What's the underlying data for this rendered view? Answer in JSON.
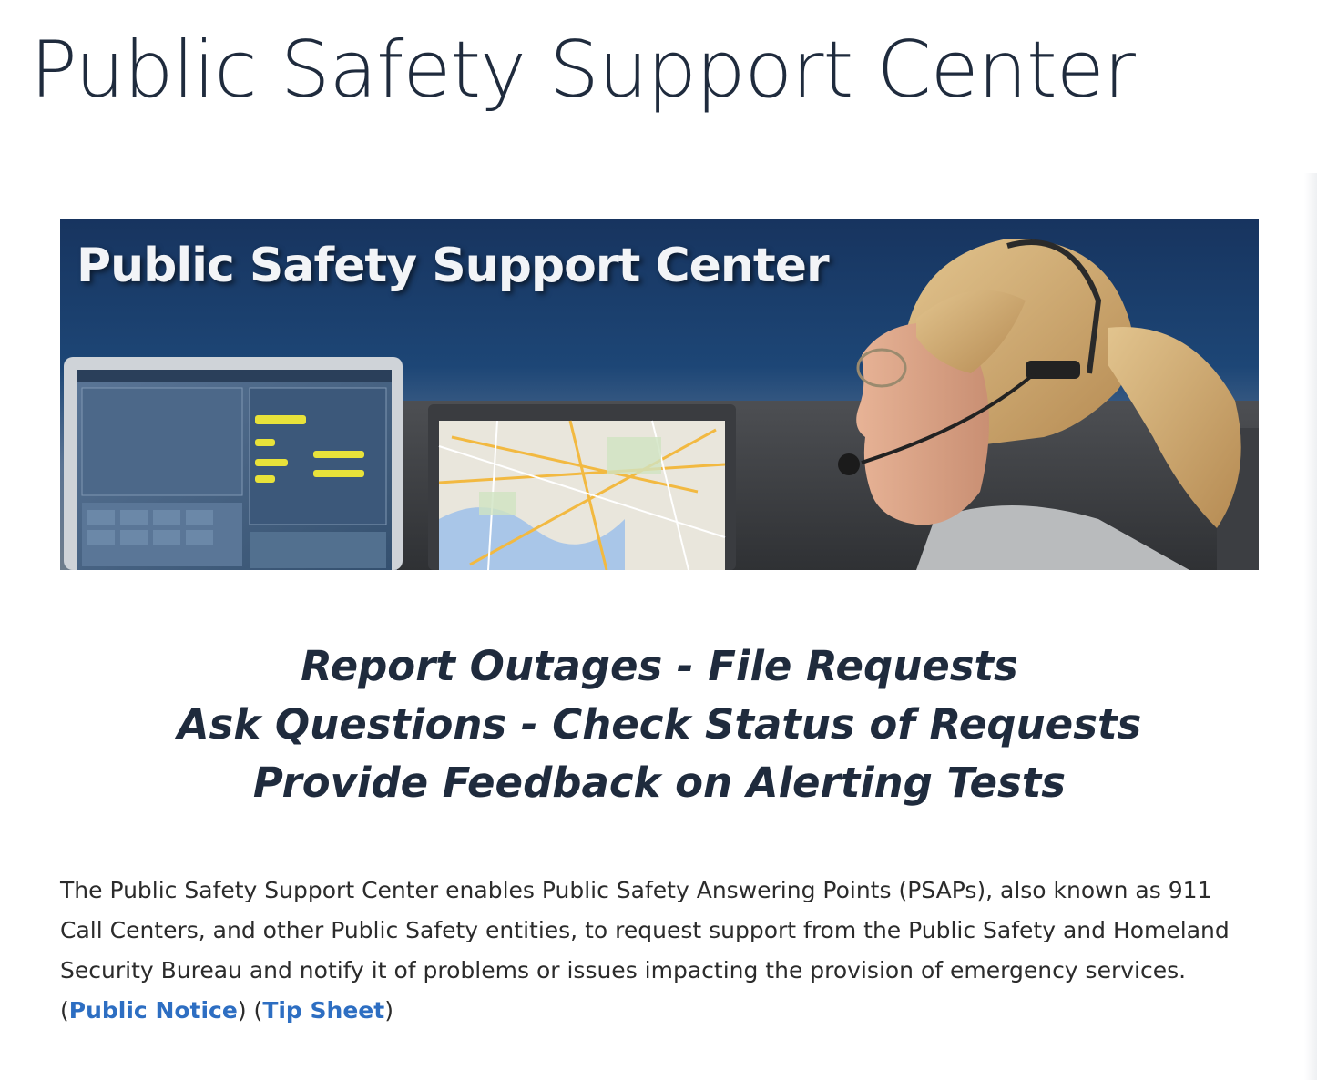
{
  "page": {
    "title": "Public Safety Support Center"
  },
  "banner": {
    "title": "Public Safety Support Center",
    "image_label": "Dispatcher wearing a headset at a 911 call center workstation with monitors"
  },
  "tagline": {
    "line1": "Report Outages - File Requests",
    "line2": "Ask Questions - Check Status of Requests",
    "line3": "Provide Feedback on Alerting Tests"
  },
  "intro": {
    "text": "The Public Safety Support Center enables Public Safety Answering Points (PSAPs), also known as 911 Call Centers, and other Public Safety entities, to request support from the Public Safety and Homeland Security Bureau and notify it of problems or issues impacting the provision of emergency services. (",
    "link1": "Public Notice",
    "sep": ") (",
    "link2": "Tip Sheet",
    "end": ")"
  },
  "colors": {
    "heading": "#1f2b3d",
    "link": "#2d6ec2",
    "banner_top": "#17345f"
  }
}
